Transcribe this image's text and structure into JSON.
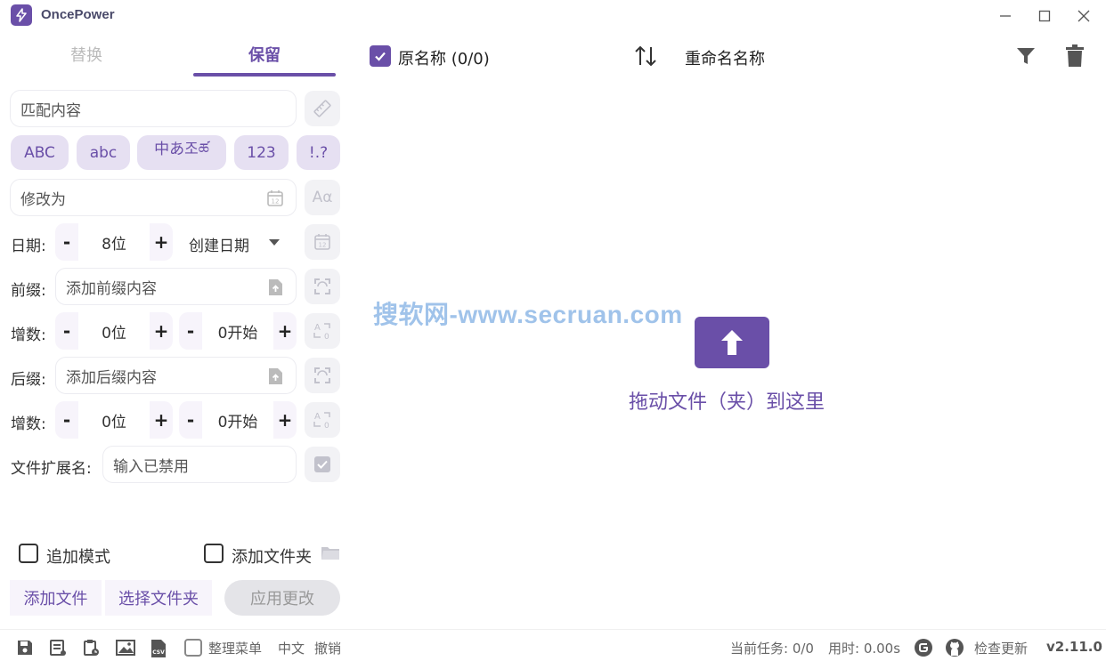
{
  "app": {
    "title": "OncePower"
  },
  "tabs": {
    "replace": "替换",
    "keep": "保留"
  },
  "left": {
    "match_placeholder": "匹配内容",
    "chips": [
      "ABC",
      "abc",
      "中あ조ཚ",
      "123",
      "!.?"
    ],
    "modify_placeholder": "修改为",
    "date": {
      "label": "日期:",
      "value": "8位",
      "mode": "创建日期"
    },
    "prefix": {
      "label": "前缀:",
      "placeholder": "添加前缀内容"
    },
    "prefix_inc": {
      "label": "增数:",
      "digits": "0位",
      "start": "0开始"
    },
    "suffix": {
      "label": "后缀:",
      "placeholder": "添加后缀内容"
    },
    "suffix_inc": {
      "label": "增数:",
      "digits": "0位",
      "start": "0开始"
    },
    "ext": {
      "label": "文件扩展名:",
      "placeholder": "输入已禁用"
    },
    "append_mode": "追加模式",
    "add_folder": "添加文件夹",
    "btn_add_file": "添加文件",
    "btn_select_folder": "选择文件夹",
    "btn_apply": "应用更改",
    "minus": "-",
    "plus": "+"
  },
  "right": {
    "original_name": "原名称 (0/0)",
    "rename_name": "重命名名称",
    "drop_text": "拖动文件（夹）到这里",
    "watermark": "搜软网-www.secruan.com"
  },
  "status": {
    "organize_menu": "整理菜单",
    "language": "中文",
    "undo": "撤销",
    "task": "当前任务: 0/0",
    "time": "用时: 0.00s",
    "check_update": "检查更新",
    "version": "v2.11.0"
  },
  "colors": {
    "accent": "#6a4fa8",
    "chip_bg": "#e6e0f2"
  }
}
